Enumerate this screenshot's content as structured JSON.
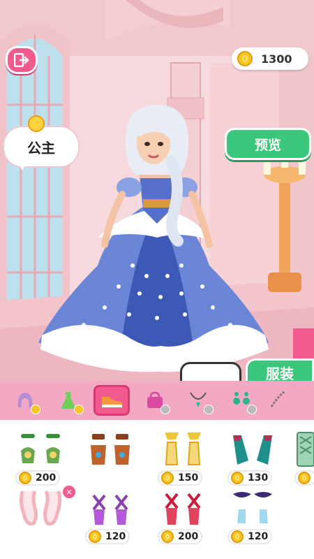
{
  "header": {
    "coins": "1300"
  },
  "character": {
    "name_bubble": "公主"
  },
  "buttons": {
    "preview": "预览",
    "outfit_tab": "服装"
  },
  "categories": [
    {
      "name": "hair",
      "selected": false
    },
    {
      "name": "dress",
      "selected": false
    },
    {
      "name": "shoes",
      "selected": true
    },
    {
      "name": "bag",
      "selected": false
    },
    {
      "name": "necklace",
      "selected": false
    },
    {
      "name": "earrings",
      "selected": false
    },
    {
      "name": "bracelet",
      "selected": false
    }
  ],
  "items": [
    {
      "name": "green-flower-heels",
      "price": "200"
    },
    {
      "name": "brown-boots",
      "price": ""
    },
    {
      "name": "gold-bow-heels",
      "price": "150"
    },
    {
      "name": "teal-boots",
      "price": "130"
    },
    {
      "name": "green-lace-boots",
      "price": ""
    },
    {
      "name": "none-shoes",
      "price": ""
    },
    {
      "name": "purple-strappy-heels",
      "price": "120"
    },
    {
      "name": "red-strappy-heels",
      "price": "200"
    },
    {
      "name": "purple-bow-heels",
      "price": "120"
    }
  ],
  "colors": {
    "accent_pink": "#f25a8f",
    "accent_green": "#3bc77b",
    "coin": "#f7c623"
  }
}
